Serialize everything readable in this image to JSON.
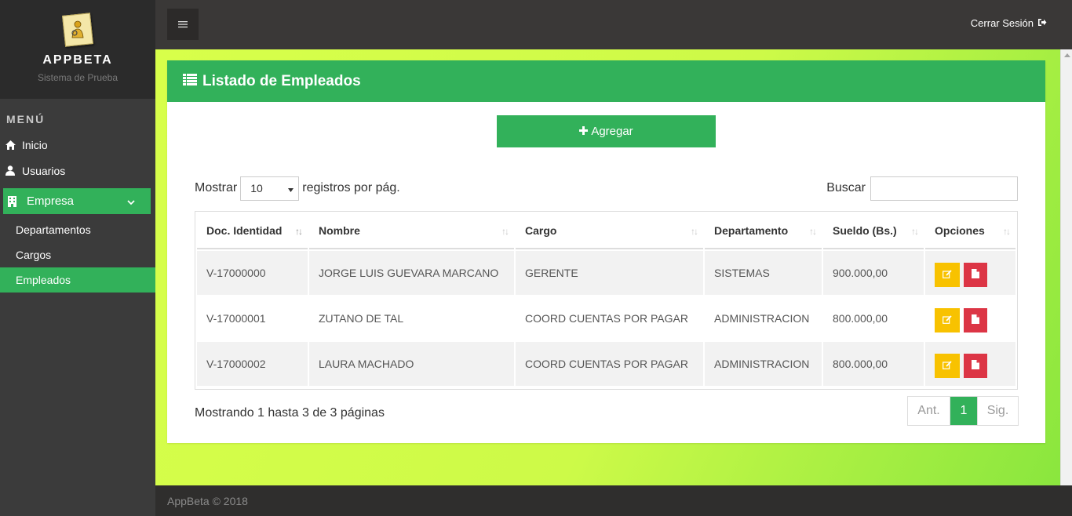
{
  "brand": {
    "title": "APPBETA",
    "subtitle": "Sistema de Prueba"
  },
  "sidebar": {
    "header": "MENÚ",
    "items": [
      {
        "label": "Inicio",
        "icon": "home-icon"
      },
      {
        "label": "Usuarios",
        "icon": "user-icon"
      }
    ],
    "group": {
      "label": "Empresa",
      "icon": "building-icon",
      "expanded": true
    },
    "sub_items": [
      {
        "label": "Departamentos",
        "active": false
      },
      {
        "label": "Cargos",
        "active": false
      },
      {
        "label": "Empleados",
        "active": true
      }
    ]
  },
  "topbar": {
    "logout_label": "Cerrar Sesión"
  },
  "panel": {
    "title": "Listado de Empleados",
    "add_label": "Agregar"
  },
  "controls": {
    "show_label": "Mostrar",
    "page_size": "10",
    "per_page_label": "registros por pág.",
    "search_label": "Buscar",
    "search_value": ""
  },
  "table": {
    "columns": [
      "Doc. Identidad",
      "Nombre",
      "Cargo",
      "Departamento",
      "Sueldo (Bs.)",
      "Opciones"
    ],
    "rows": [
      {
        "doc": "V-17000000",
        "nombre": "JORGE LUIS GUEVARA MARCANO",
        "cargo": "GERENTE",
        "departamento": "SISTEMAS",
        "sueldo": "900.000,00"
      },
      {
        "doc": "V-17000001",
        "nombre": "ZUTANO DE TAL",
        "cargo": "COORD CUENTAS POR PAGAR",
        "departamento": "ADMINISTRACION",
        "sueldo": "800.000,00"
      },
      {
        "doc": "V-17000002",
        "nombre": "LAURA MACHADO",
        "cargo": "COORD CUENTAS POR PAGAR",
        "departamento": "ADMINISTRACION",
        "sueldo": "800.000,00"
      }
    ]
  },
  "pagination": {
    "info": "Mostrando 1 hasta 3 de 3 páginas",
    "prev": "Ant.",
    "current": "1",
    "next": "Sig."
  },
  "footer": {
    "text": "AppBeta © 2018"
  },
  "colors": {
    "accent": "#32b15a",
    "edit": "#f8c200",
    "delete": "#dc3545",
    "sidebar": "#3b3b3b"
  }
}
